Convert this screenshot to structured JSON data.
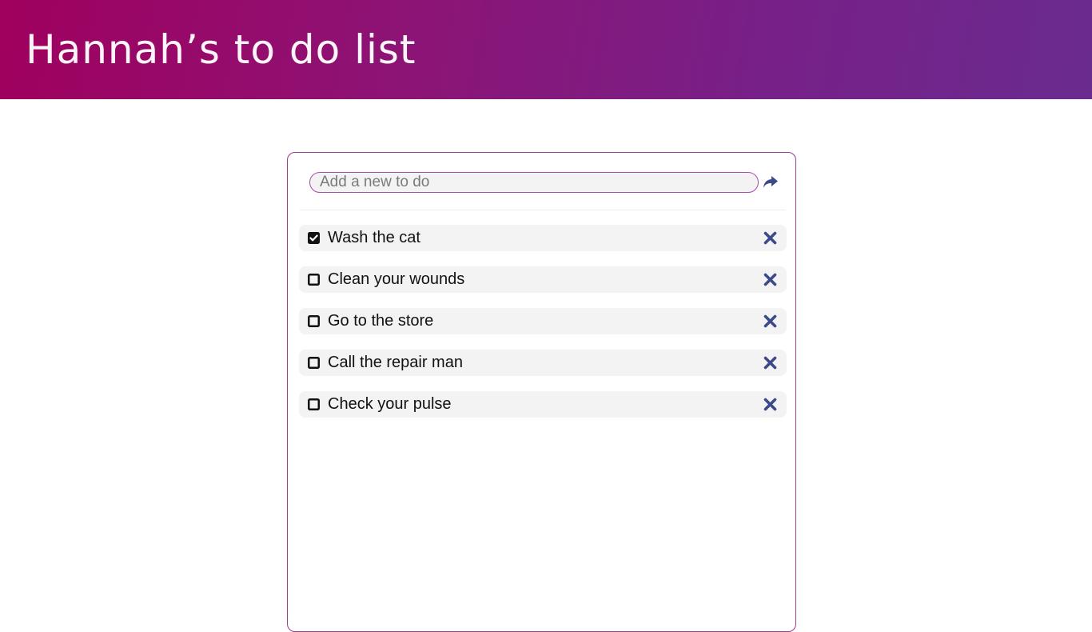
{
  "header": {
    "title": "Hannah’s to do list"
  },
  "add_todo": {
    "placeholder": "Add a new to do",
    "value": "",
    "submit_icon": "share-arrow-icon"
  },
  "colors": {
    "accent": "#3d4a8a",
    "border": "#9b3a8f",
    "header_start": "#a0005e",
    "header_end": "#6a2b8f"
  },
  "todos": [
    {
      "label": "Wash the cat",
      "checked": true
    },
    {
      "label": "Clean your wounds",
      "checked": false
    },
    {
      "label": "Go to the store",
      "checked": false
    },
    {
      "label": "Call the repair man",
      "checked": false
    },
    {
      "label": "Check your pulse",
      "checked": false
    }
  ]
}
